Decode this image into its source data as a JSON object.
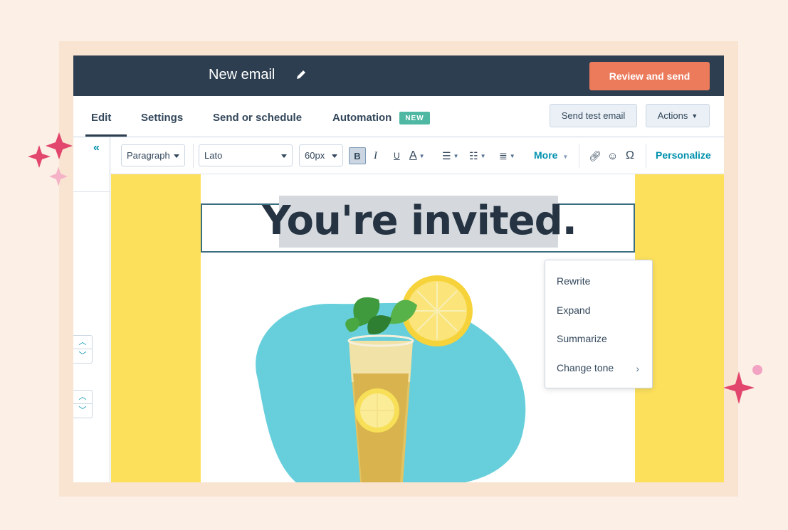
{
  "header": {
    "title": "New email",
    "review_button": "Review and send"
  },
  "tabs": {
    "edit": "Edit",
    "settings": "Settings",
    "send_or_schedule": "Send or schedule",
    "automation": "Automation",
    "new_badge": "NEW",
    "send_test_button": "Send test email",
    "actions_button": "Actions"
  },
  "left_panel": {
    "collapse": "«",
    "up": "^",
    "down": "v"
  },
  "toolbar": {
    "paragraph": "Paragraph",
    "font": "Lato",
    "size": "60px",
    "bold": "B",
    "italic": "I",
    "underline": "U",
    "text_color": "A",
    "more": "More",
    "personalize": "Personalize"
  },
  "email": {
    "heading": "You're invited."
  },
  "context_menu": {
    "items": [
      "Rewrite",
      "Expand",
      "Summarize",
      "Change tone"
    ]
  },
  "colors": {
    "header_bg": "#2d3e50",
    "accent_orange": "#ec7b5c",
    "canvas_yellow": "#fce05c",
    "blob_teal": "#67cfdb",
    "link_teal": "#0091ae",
    "sparkle_pink": "#e2466c"
  }
}
